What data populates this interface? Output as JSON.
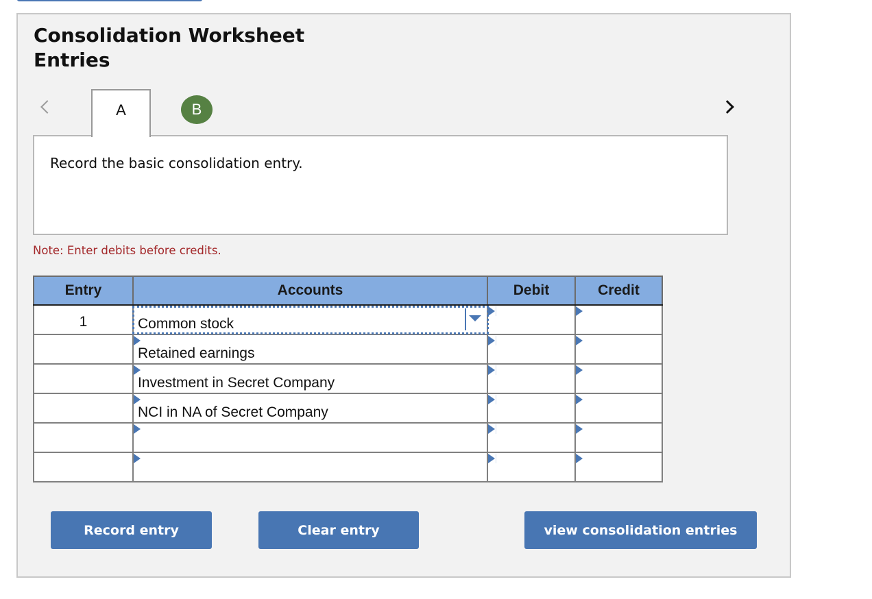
{
  "page": {
    "title": "Consolidation Worksheet Entries"
  },
  "nav": {
    "prev_icon": "chevron-left-icon",
    "next_icon": "chevron-right-icon",
    "tabs": [
      {
        "label": "A",
        "state": "active"
      },
      {
        "label": "B",
        "state": "completed",
        "color": "#568143"
      }
    ]
  },
  "instruction": "Record the basic consolidation entry.",
  "note": "Note: Enter debits before credits.",
  "journal": {
    "headers": {
      "entry": "Entry",
      "accounts": "Accounts",
      "debit": "Debit",
      "credit": "Credit"
    },
    "rows": [
      {
        "entry": "1",
        "account": "Common stock",
        "debit": "",
        "credit": ""
      },
      {
        "entry": "",
        "account": "Retained earnings",
        "debit": "",
        "credit": ""
      },
      {
        "entry": "",
        "account": "Investment in Secret Company",
        "debit": "",
        "credit": ""
      },
      {
        "entry": "",
        "account": "NCI in NA of Secret Company",
        "debit": "",
        "credit": ""
      },
      {
        "entry": "",
        "account": "",
        "debit": "",
        "credit": ""
      },
      {
        "entry": "",
        "account": "",
        "debit": "",
        "credit": ""
      }
    ]
  },
  "buttons": {
    "record": "Record entry",
    "clear": "Clear entry",
    "view": "view consolidation entries"
  },
  "colors": {
    "accent": "#4876b3",
    "header_bg": "#84ace0",
    "note": "#a3282a",
    "tab_completed": "#568143"
  }
}
